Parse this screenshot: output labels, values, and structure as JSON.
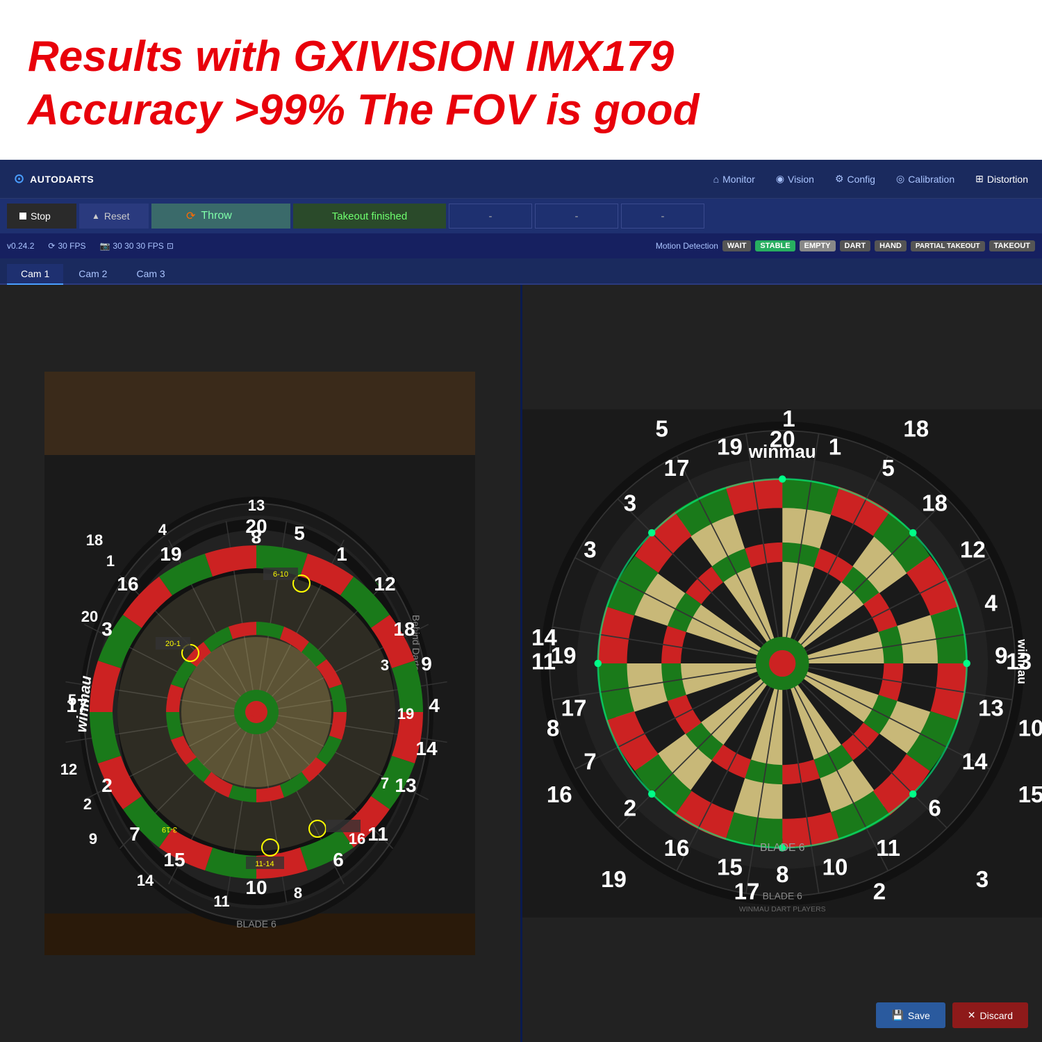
{
  "annotation": {
    "line1": "Results with  GXIVISION   IMX179",
    "line2": "Accuracy >99%  The FOV is good"
  },
  "navbar": {
    "brand": "AUTODARTS",
    "links": [
      {
        "id": "monitor",
        "icon": "⌂",
        "label": "Monitor"
      },
      {
        "id": "vision",
        "icon": "👁",
        "label": "Vision"
      },
      {
        "id": "config",
        "icon": "⚙",
        "label": "Config"
      },
      {
        "id": "calibration",
        "icon": "◎",
        "label": "Calibration"
      },
      {
        "id": "distortion",
        "icon": "⊞",
        "label": "Distortion"
      }
    ]
  },
  "toolbar": {
    "stop_label": "Stop",
    "reset_label": "Reset",
    "throw_label": "Throw",
    "takeout_label": "Takeout finished",
    "dash1": "-",
    "dash2": "-",
    "dash3": "-"
  },
  "statusbar": {
    "version": "v0.24.2",
    "fps_icon": "30 FPS",
    "cam_fps": "30 30 30 FPS",
    "motion_label": "Motion Detection",
    "badges": [
      "WAIT",
      "STABLE",
      "EMPTY",
      "DART",
      "HAND",
      "PARTIAL TAKEOUT",
      "TAKEOUT"
    ]
  },
  "tabs": {
    "items": [
      "Cam 1",
      "Cam 2",
      "Cam 3"
    ],
    "active": 0
  },
  "footer": {
    "save_label": "Save",
    "discard_label": "Discard"
  },
  "colors": {
    "accent_blue": "#4a9eff",
    "nav_bg": "#1a2a5e",
    "throw_green": "#7fffaa",
    "takeout_green": "#6fff6f"
  }
}
